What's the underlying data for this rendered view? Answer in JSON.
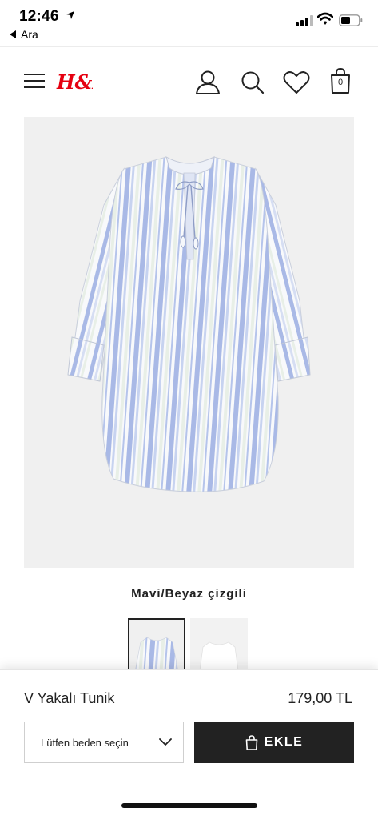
{
  "status_bar": {
    "time": "12:46",
    "back_label": "Ara"
  },
  "header": {
    "logo": "H&M",
    "icons": [
      "menu-icon",
      "account-icon",
      "search-icon",
      "heart-icon",
      "bag-icon"
    ],
    "bag_count": "0",
    "brand_color": "#e50010"
  },
  "product": {
    "color_name": "Mavi/Beyaz çizgili",
    "title": "V Yakalı Tunik",
    "price": "179,00 TL",
    "size_placeholder": "Lütfen beden seçin",
    "add_label": "EKLE",
    "stripe_colors": [
      "#a9b9e6",
      "#ffffff",
      "#e8efe7"
    ]
  }
}
